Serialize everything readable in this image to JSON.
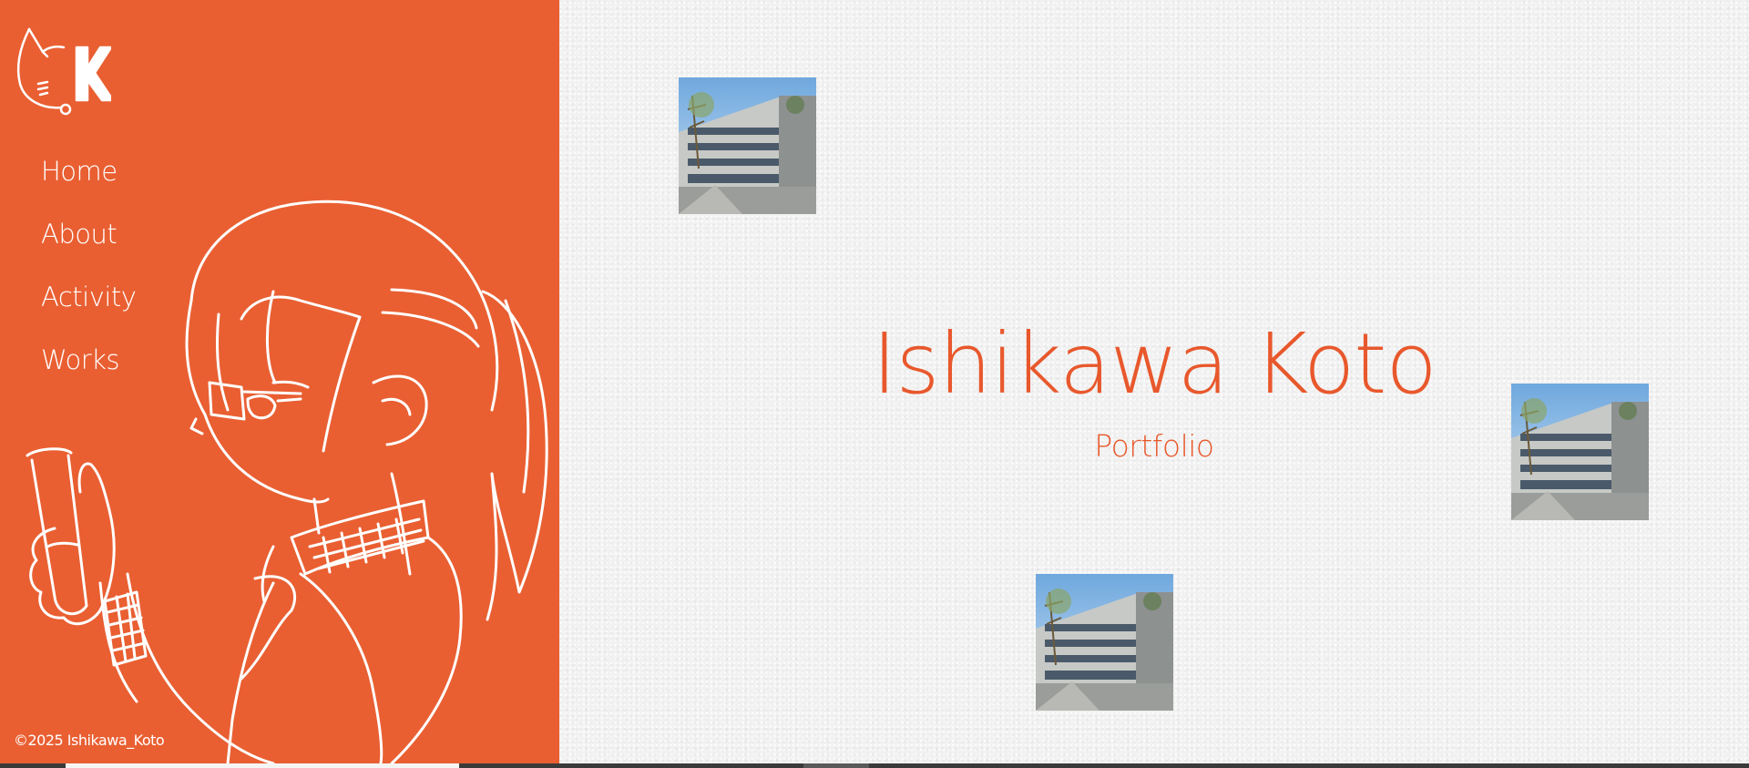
{
  "sidebar": {
    "logo_alt": "cat-logo-k",
    "nav": [
      {
        "label": "Home"
      },
      {
        "label": "About"
      },
      {
        "label": "Activity"
      },
      {
        "label": "Works"
      }
    ],
    "copyright": "©2025 Ishikawa_Koto"
  },
  "hero": {
    "title": "Ishikawa Koto",
    "subtitle": "Portfolio"
  },
  "photos": [
    {
      "subject": "school-building"
    },
    {
      "subject": "school-building"
    },
    {
      "subject": "school-building"
    }
  ],
  "colors": {
    "sidebar_bg": "#e95f32",
    "accent_text": "#e8582c",
    "paper_bg": "#f1f1f1",
    "line_art": "#ffffff"
  }
}
